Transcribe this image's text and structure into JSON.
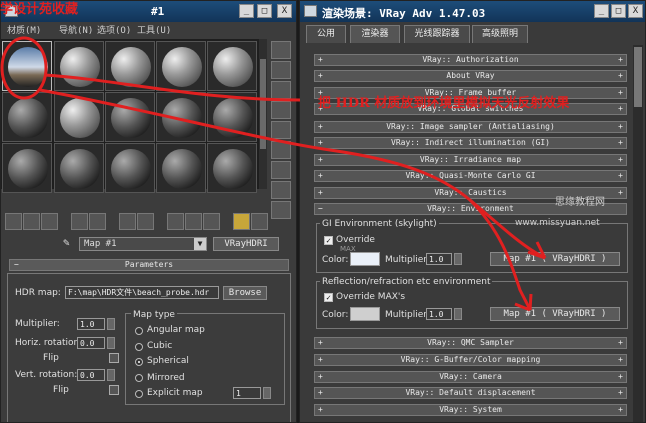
{
  "material_editor": {
    "title_overlay": "学设计苑收藏",
    "title": "#1",
    "menu": [
      "材质(M)",
      "导航(N)",
      "选项(O)",
      "工具(U)"
    ],
    "window_buttons": [
      "_",
      "□",
      "X"
    ],
    "map_name": "Map #1",
    "map_type": "VRayHDRI",
    "parameters_header": "Parameters",
    "hdr_map_label": "HDR map:",
    "hdr_map_path": "F:\\map\\HDR文件\\beach_probe.hdr",
    "browse_label": "Browse",
    "multiplier_label": "Multiplier:",
    "multiplier_value": "1.0",
    "horiz_rotation_label": "Horiz. rotation:",
    "horiz_rotation_value": "0.0",
    "flip_label_1": "Flip",
    "vert_rotation_label": "Vert. rotation:",
    "vert_rotation_value": "0.0",
    "flip_label_2": "Flip",
    "map_type_header": "Map type",
    "map_types": [
      "Angular map",
      "Cubic",
      "Spherical",
      "Mirrored",
      "Explicit map"
    ],
    "selected_map_type": "Spherical",
    "explicit_map_value": "1"
  },
  "render_scene": {
    "title": "渲染场景: VRay Adv 1.47.03",
    "window_buttons": [
      "_",
      "□",
      "X"
    ],
    "tabs": [
      "公用",
      "渲染器",
      "光线跟踪器",
      "高级照明"
    ],
    "active_tab": "渲染器",
    "rollouts_top": [
      "VRay:: Authorization",
      "About VRay",
      "VRay:: Frame buffer",
      "VRay:: Global switches",
      "VRay:: Image sampler (Antialiasing)",
      "VRay:: Indirect illumination (GI)",
      "VRay:: Irradiance map",
      "VRay:: Quasi-Monte Carlo GI",
      "VRay:: Caustics",
      "VRay:: Environment"
    ],
    "gi_environment_label": "GI Environment (skylight)",
    "override_label": "Override",
    "override_mtl_label": "MAX",
    "color_label": "Color:",
    "multiplier_label": "Multiplier:",
    "gi_multiplier_value": "1.0",
    "gi_map_label": "Map #1  ( VRayHDRI )",
    "reflection_label": "Reflection/refraction etc environment",
    "override_max_label": "Override MAX's",
    "refl_multiplier_value": "1.0",
    "refl_map_label": "Map #1  ( VRayHDRI )",
    "rollouts_bottom": [
      "VRay:: QMC Sampler",
      "VRay:: G-Buffer/Color mapping",
      "VRay:: Camera",
      "VRay:: Default displacement",
      "VRay:: System"
    ]
  },
  "annotation": {
    "text": "把 HDR 材质放到环境里模拟天光反射效果",
    "watermark_line1": "思缘教程网",
    "watermark_line2": "www.missyuan.net",
    "color": "#e02020"
  }
}
